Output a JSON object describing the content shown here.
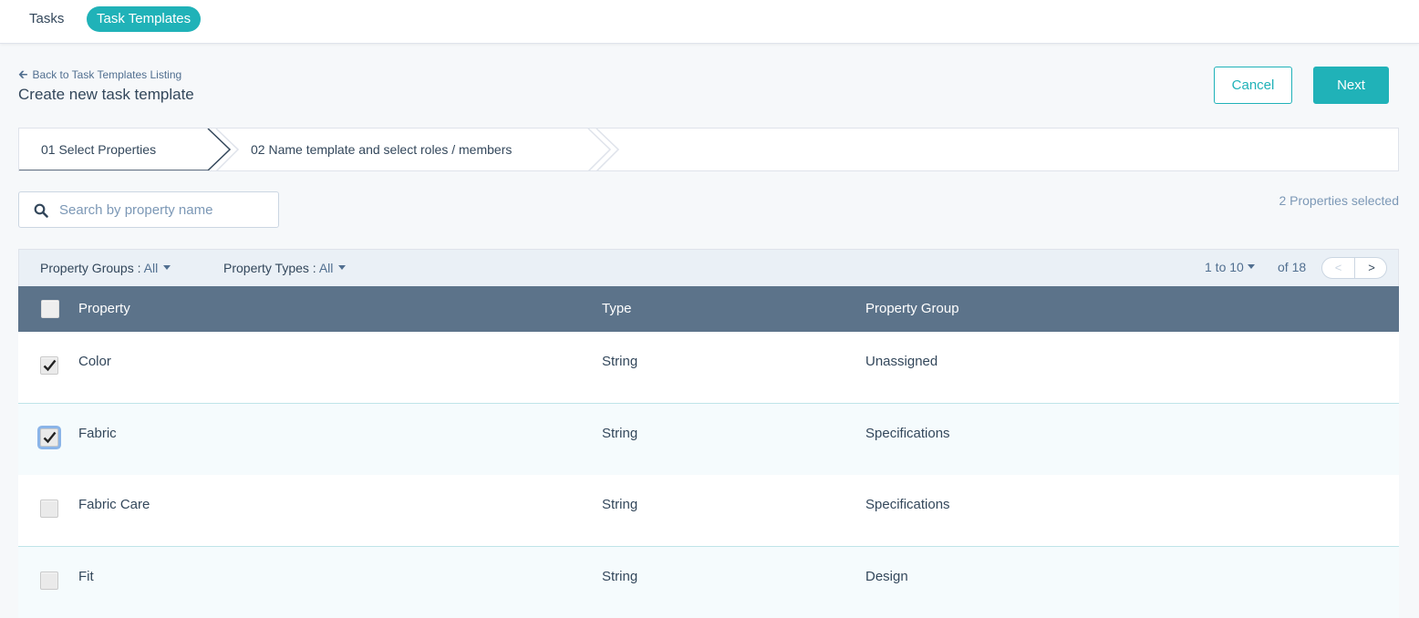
{
  "nav": {
    "tabs": [
      {
        "label": "Tasks",
        "active": false
      },
      {
        "label": "Task Templates",
        "active": true
      }
    ]
  },
  "header": {
    "back_label": "Back to Task Templates Listing",
    "title": "Create new task template",
    "cancel_label": "Cancel",
    "next_label": "Next"
  },
  "stepper": {
    "steps": [
      {
        "label": "01 Select Properties",
        "active": true
      },
      {
        "label": "02 Name template and select roles / members",
        "active": false
      }
    ]
  },
  "search": {
    "placeholder": "Search by property name",
    "value": ""
  },
  "selected_count": "2 Properties selected",
  "filters": {
    "groups_label": "Property Groups :",
    "groups_value": "All",
    "types_label": "Property Types :",
    "types_value": "All"
  },
  "pagination": {
    "range": "1 to 10",
    "of": "of 18",
    "prev": "<",
    "next": ">"
  },
  "table": {
    "columns": [
      "Property",
      "Type",
      "Property Group"
    ],
    "rows": [
      {
        "property": "Color",
        "type": "String",
        "group": "Unassigned",
        "checked": true
      },
      {
        "property": "Fabric",
        "type": "String",
        "group": "Specifications",
        "checked": true
      },
      {
        "property": "Fabric Care",
        "type": "String",
        "group": "Specifications",
        "checked": false
      },
      {
        "property": "Fit",
        "type": "String",
        "group": "Design",
        "checked": false
      }
    ]
  },
  "colors": {
    "accent": "#20b2b8",
    "header_bg": "#5c738a",
    "text": "#33475b"
  }
}
